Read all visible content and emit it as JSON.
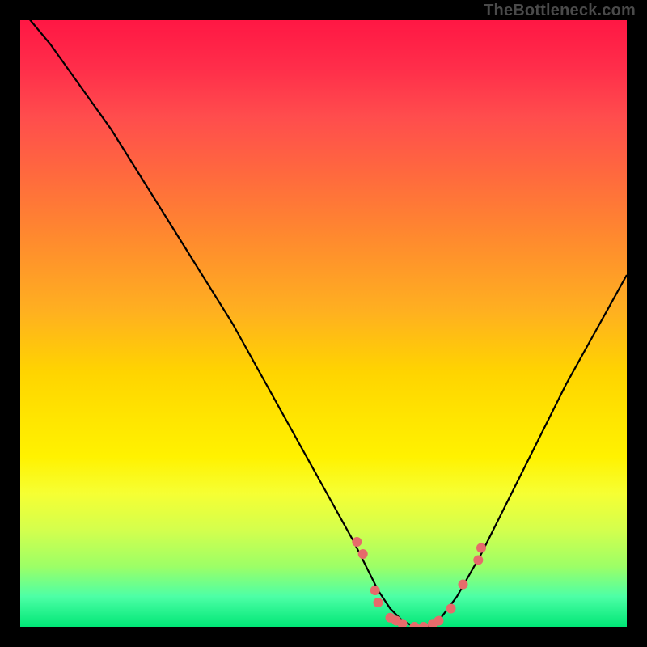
{
  "watermark": "TheBottleneck.com",
  "chart_data": {
    "type": "line",
    "title": "",
    "xlabel": "",
    "ylabel": "",
    "xlim": [
      0,
      100
    ],
    "ylim": [
      0,
      100
    ],
    "grid": false,
    "legend": false,
    "gradient_direction": "vertical",
    "gradient_stops": [
      {
        "pos": 0,
        "color": "#ff1744"
      },
      {
        "pos": 16,
        "color": "#ff4d4d"
      },
      {
        "pos": 36,
        "color": "#ff8a2e"
      },
      {
        "pos": 58,
        "color": "#ffd400"
      },
      {
        "pos": 78,
        "color": "#f6ff33"
      },
      {
        "pos": 90,
        "color": "#9dff66"
      },
      {
        "pos": 100,
        "color": "#00e676"
      }
    ],
    "series": [
      {
        "name": "bottleneck-curve",
        "stroke": "#000000",
        "x": [
          0,
          5,
          10,
          15,
          20,
          25,
          30,
          35,
          40,
          45,
          50,
          55,
          57,
          59,
          61,
          63,
          65,
          67,
          69,
          72,
          76,
          80,
          85,
          90,
          95,
          100
        ],
        "y": [
          102,
          96,
          89,
          82,
          74,
          66,
          58,
          50,
          41,
          32,
          23,
          14,
          10,
          6,
          3,
          1,
          0,
          0,
          1,
          5,
          12,
          20,
          30,
          40,
          49,
          58
        ]
      }
    ],
    "scatter_points": {
      "name": "curve-markers",
      "color": "#e66b6b",
      "radius": 6,
      "points": [
        {
          "x": 55.5,
          "y": 14
        },
        {
          "x": 56.5,
          "y": 12
        },
        {
          "x": 58.5,
          "y": 6
        },
        {
          "x": 59.0,
          "y": 4
        },
        {
          "x": 61.0,
          "y": 1.5
        },
        {
          "x": 62.0,
          "y": 1
        },
        {
          "x": 63.0,
          "y": 0.5
        },
        {
          "x": 65.0,
          "y": 0
        },
        {
          "x": 66.5,
          "y": 0
        },
        {
          "x": 68.0,
          "y": 0.5
        },
        {
          "x": 69.0,
          "y": 1
        },
        {
          "x": 71.0,
          "y": 3
        },
        {
          "x": 73.0,
          "y": 7
        },
        {
          "x": 75.5,
          "y": 11
        },
        {
          "x": 76.0,
          "y": 13
        }
      ]
    }
  }
}
